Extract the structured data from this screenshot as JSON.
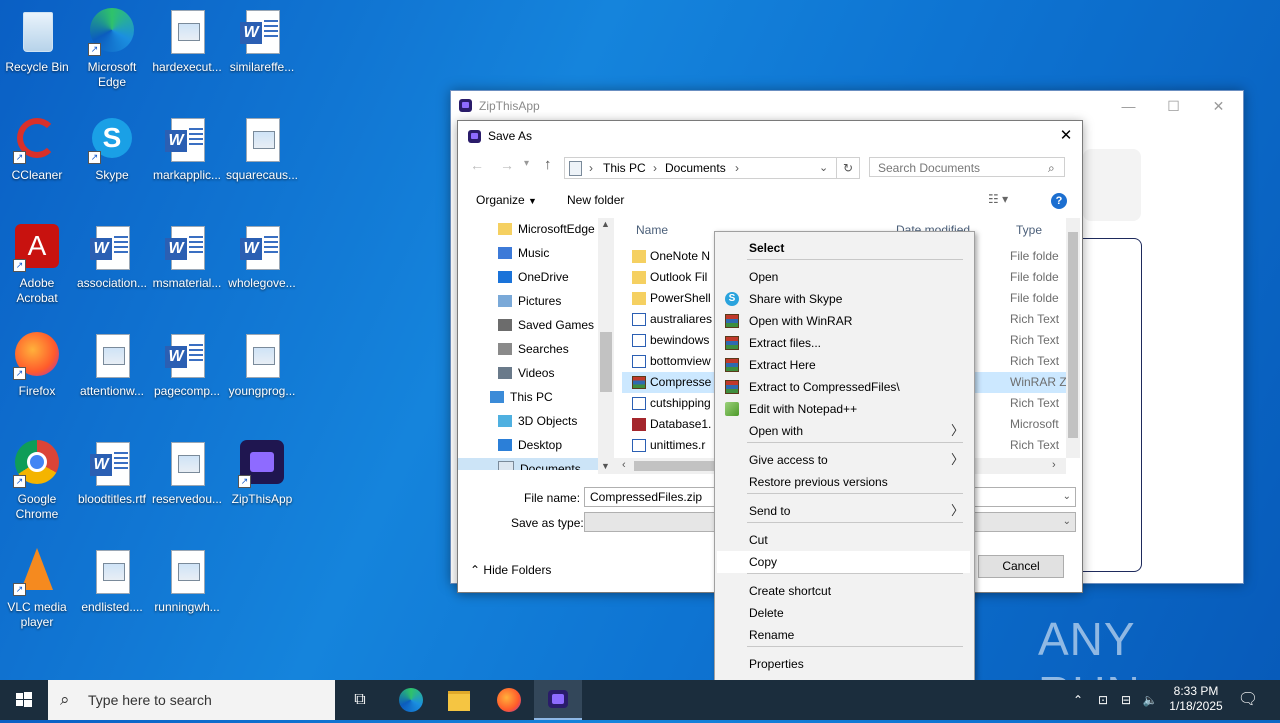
{
  "desktop": {
    "icons": [
      {
        "label": "Recycle Bin",
        "icon": "recycle-bin-icon"
      },
      {
        "label": "Microsoft Edge",
        "icon": "edge-icon"
      },
      {
        "label": "hardexecut...",
        "icon": "image-file-icon"
      },
      {
        "label": "similareffe...",
        "icon": "word-doc-icon"
      },
      {
        "label": "CCleaner",
        "icon": "ccleaner-icon"
      },
      {
        "label": "Skype",
        "icon": "skype-icon"
      },
      {
        "label": "markapplic...",
        "icon": "word-doc-icon"
      },
      {
        "label": "squarecaus...",
        "icon": "image-file-icon"
      },
      {
        "label": "Adobe Acrobat",
        "icon": "acrobat-icon"
      },
      {
        "label": "association...",
        "icon": "word-doc-icon"
      },
      {
        "label": "msmaterial...",
        "icon": "word-doc-icon"
      },
      {
        "label": "wholegove...",
        "icon": "word-doc-icon"
      },
      {
        "label": "Firefox",
        "icon": "firefox-icon"
      },
      {
        "label": "attentionw...",
        "icon": "image-file-icon"
      },
      {
        "label": "pagecomp...",
        "icon": "word-doc-icon"
      },
      {
        "label": "youngprog...",
        "icon": "image-file-icon"
      },
      {
        "label": "Google Chrome",
        "icon": "chrome-icon"
      },
      {
        "label": "bloodtitles.rtf",
        "icon": "word-doc-icon"
      },
      {
        "label": "reservedou...",
        "icon": "image-file-icon"
      },
      {
        "label": "ZipThisApp",
        "icon": "zipthisapp-icon"
      },
      {
        "label": "VLC media player",
        "icon": "vlc-icon"
      },
      {
        "label": "endlisted....",
        "icon": "image-file-icon"
      },
      {
        "label": "runningwh...",
        "icon": "image-file-icon"
      }
    ]
  },
  "app_window": {
    "title": "ZipThisApp"
  },
  "dialog": {
    "title": "Save As",
    "breadcrumb": [
      "This PC",
      "Documents"
    ],
    "search_placeholder": "Search Documents",
    "organize_label": "Organize",
    "new_folder_label": "New folder",
    "tree": [
      {
        "label": "MicrosoftEdge",
        "icon": "folder-icon"
      },
      {
        "label": "Music",
        "icon": "music-icon"
      },
      {
        "label": "OneDrive",
        "icon": "onedrive-icon"
      },
      {
        "label": "Pictures",
        "icon": "pictures-icon"
      },
      {
        "label": "Saved Games",
        "icon": "saved-games-icon"
      },
      {
        "label": "Searches",
        "icon": "search-icon"
      },
      {
        "label": "Videos",
        "icon": "videos-icon"
      },
      {
        "label": "This PC",
        "icon": "computer-icon"
      },
      {
        "label": "3D Objects",
        "icon": "3d-objects-icon"
      },
      {
        "label": "Desktop",
        "icon": "desktop-icon"
      },
      {
        "label": "Documents",
        "icon": "documents-icon"
      }
    ],
    "columns": {
      "name": "Name",
      "date": "Date modified",
      "type": "Type"
    },
    "files": [
      {
        "name": "OneNote N",
        "date": "PM",
        "type": "File folde",
        "icon": "folder-icon"
      },
      {
        "name": "Outlook Fil",
        "date": "6 AM",
        "type": "File folde",
        "icon": "folder-icon"
      },
      {
        "name": "PowerShell",
        "date": "PM",
        "type": "File folde",
        "icon": "folder-icon"
      },
      {
        "name": "australiares",
        "date": "AM",
        "type": "Rich Text",
        "icon": "word-doc-icon"
      },
      {
        "name": "bewindows",
        "date": "AM",
        "type": "Rich Text",
        "icon": "word-doc-icon"
      },
      {
        "name": "bottomview",
        "date": "AM",
        "type": "Rich Text",
        "icon": "word-doc-icon"
      },
      {
        "name": "Compresse",
        "date": "PM",
        "type": "WinRAR Z",
        "icon": "winrar-icon"
      },
      {
        "name": "cutshipping",
        "date": "PM",
        "type": "Rich Text",
        "icon": "word-doc-icon"
      },
      {
        "name": "Database1.",
        "date": "7 AM",
        "type": "Microsoft",
        "icon": "access-icon"
      },
      {
        "name": "unittimes.r",
        "date": "AM",
        "type": "Rich Text",
        "icon": "word-doc-icon"
      }
    ],
    "file_name_label": "File name:",
    "file_name_value": "CompressedFiles.zip",
    "save_type_label": "Save as type:",
    "hide_folders_label": "Hide Folders",
    "cancel_label": "Cancel"
  },
  "context_menu": {
    "items": [
      {
        "label": "Select",
        "bold": true
      },
      {
        "label": "Open"
      },
      {
        "label": "Share with Skype",
        "icon": "skype-icon"
      },
      {
        "label": "Open with WinRAR",
        "icon": "winrar-icon"
      },
      {
        "label": "Extract files...",
        "icon": "winrar-icon"
      },
      {
        "label": "Extract Here",
        "icon": "winrar-icon"
      },
      {
        "label": "Extract to CompressedFiles\\",
        "icon": "winrar-icon"
      },
      {
        "label": "Edit with Notepad++",
        "icon": "notepad-plus-icon"
      },
      {
        "label": "Open with",
        "submenu": true
      },
      {
        "label": "Give access to",
        "submenu": true
      },
      {
        "label": "Restore previous versions"
      },
      {
        "label": "Send to",
        "submenu": true
      },
      {
        "label": "Cut"
      },
      {
        "label": "Copy"
      },
      {
        "label": "Create shortcut"
      },
      {
        "label": "Delete"
      },
      {
        "label": "Rename"
      },
      {
        "label": "Properties"
      }
    ]
  },
  "taskbar": {
    "search_placeholder": "Type here to search",
    "time": "8:33 PM",
    "date": "1/18/2025"
  },
  "watermark": "ANY RUN"
}
